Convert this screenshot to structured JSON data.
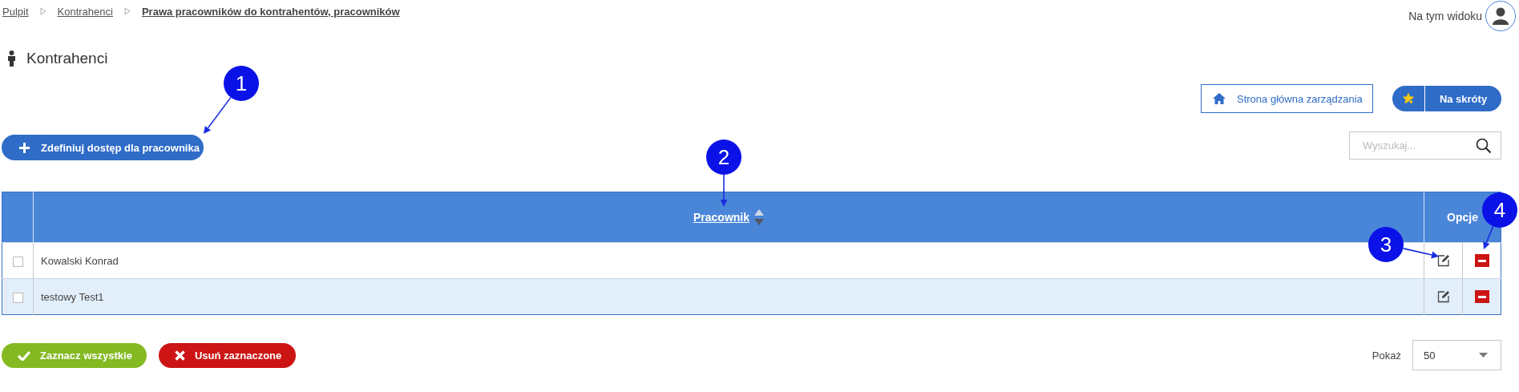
{
  "breadcrumb": [
    {
      "label": "Pulpit",
      "current": false
    },
    {
      "label": "Kontrahenci",
      "current": false
    },
    {
      "label": "Prawa pracowników do kontrahentów, pracowników",
      "current": true
    }
  ],
  "user_menu": {
    "label": "Na tym widoku"
  },
  "page_title": "Kontrahenci",
  "home_button": "Strona główna zarządzania",
  "shortcuts_button": "Na skróty",
  "add_button": "Zdefiniuj dostęp dla pracownika",
  "search": {
    "placeholder": "Wyszukaj..."
  },
  "table": {
    "columns": [
      {
        "label": "Pracownik",
        "sortable": true
      },
      {
        "label": "Opcje",
        "sortable": false
      }
    ],
    "rows": [
      {
        "name": "Kowalski Konrad",
        "checked": false
      },
      {
        "name": "testowy Test1",
        "checked": false
      }
    ]
  },
  "select_all_button": "Zaznacz wszystkie",
  "delete_selected_button": "Usuń zaznaczone",
  "page_size": {
    "label": "Pokaż",
    "value": "50"
  },
  "callouts": [
    {
      "number": "1"
    },
    {
      "number": "2"
    },
    {
      "number": "3"
    },
    {
      "number": "4"
    }
  ]
}
